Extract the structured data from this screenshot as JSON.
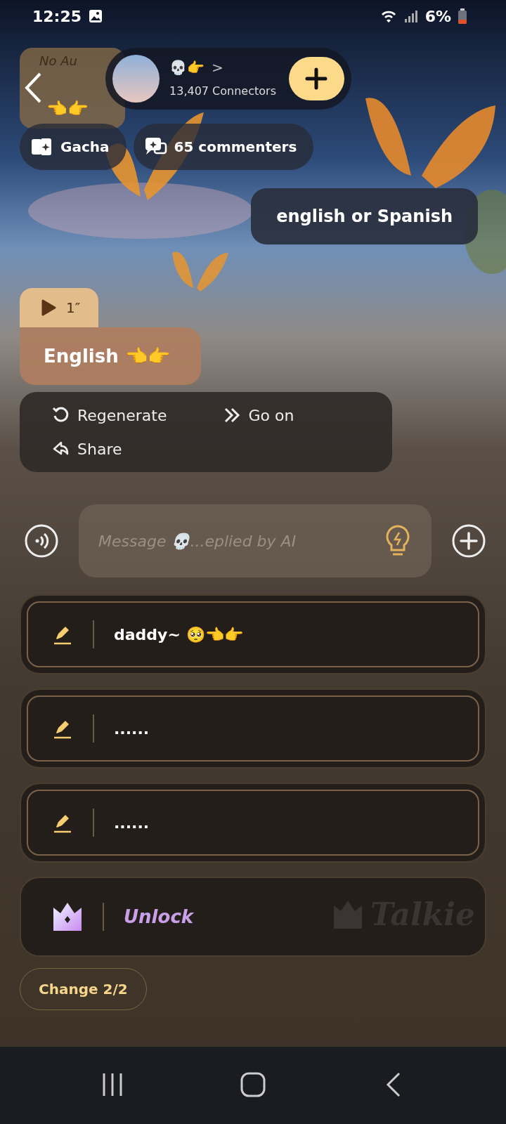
{
  "status_bar": {
    "time": "12:25",
    "battery": "6%"
  },
  "header": {
    "card_label": "No Au",
    "card_emoji": "👈👉",
    "character_name": "💀👉",
    "chevron": ">",
    "connectors": "13,407 Connectors"
  },
  "chips": [
    {
      "kind": "gacha",
      "label": "Gacha"
    },
    {
      "kind": "comments",
      "label": "65 commenters"
    }
  ],
  "messages": [
    {
      "kind": "user",
      "text": "english or Spanish"
    },
    {
      "kind": "ai",
      "voice": "1″",
      "text": "English 👈👉"
    }
  ],
  "actions": [
    {
      "kind": "regenerate",
      "label": "Regenerate"
    },
    {
      "kind": "go_on",
      "label": "Go on"
    },
    {
      "kind": "share",
      "label": "Share"
    }
  ],
  "composer": {
    "placeholder": "Message 💀...eplied by AI"
  },
  "suggestions": [
    {
      "kind": "reply",
      "text": "daddy~ 🥺👈👉"
    },
    {
      "kind": "reply",
      "text": "......"
    },
    {
      "kind": "reply",
      "text": "......"
    },
    {
      "kind": "unlock",
      "text": "Unlock",
      "brand": "Talkie"
    }
  ],
  "change_button": "Change 2/2"
}
